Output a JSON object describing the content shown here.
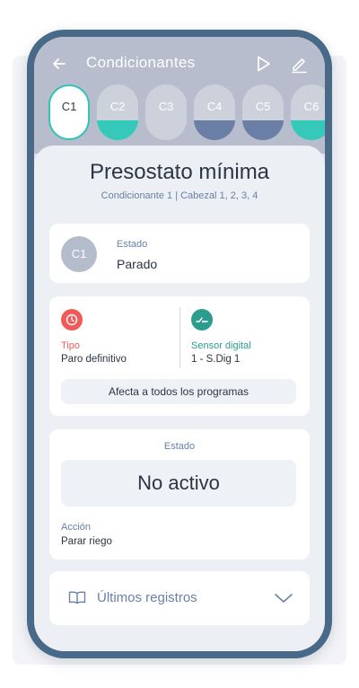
{
  "header": {
    "title": "Condicionantes",
    "back_icon": "arrow-left-icon",
    "play_icon": "play-icon",
    "edit_icon": "pencil-icon"
  },
  "chips": [
    {
      "label": "C1",
      "active": true,
      "fill_color": null
    },
    {
      "label": "C2",
      "active": false,
      "fill_color": "#36c8b8"
    },
    {
      "label": "C3",
      "active": false,
      "fill_color": null
    },
    {
      "label": "C4",
      "active": false,
      "fill_color": "#6b7ea6"
    },
    {
      "label": "C5",
      "active": false,
      "fill_color": "#6b7ea6"
    },
    {
      "label": "C6",
      "active": false,
      "fill_color": "#36c8b8"
    }
  ],
  "detail": {
    "title": "Presostato mínima",
    "subtitle": "Condicionante 1 | Cabezal 1, 2, 3, 4"
  },
  "state_card": {
    "avatar": "C1",
    "label": "Estado",
    "value": "Parado"
  },
  "type_card": {
    "type_label": "Tipo",
    "type_value": "Paro definitivo",
    "type_icon": "clock-icon",
    "type_icon_color": "#f05a5a",
    "sensor_label": "Sensor digital",
    "sensor_value": "1 - S.Dig 1",
    "sensor_icon": "switch-icon",
    "sensor_icon_color": "#2a9d8f",
    "programs_note": "Afecta a todos los programas"
  },
  "status_card": {
    "label": "Estado",
    "value": "No activo",
    "action_label": "Acción",
    "action_value": "Parar riego"
  },
  "records_card": {
    "label": "Últimos registros",
    "icon": "book-icon",
    "chevron": "chevron-down-icon"
  },
  "colors": {
    "accent": "#36c2b4",
    "phone_frame": "#486a88",
    "muted_blue": "#6b80a6"
  }
}
